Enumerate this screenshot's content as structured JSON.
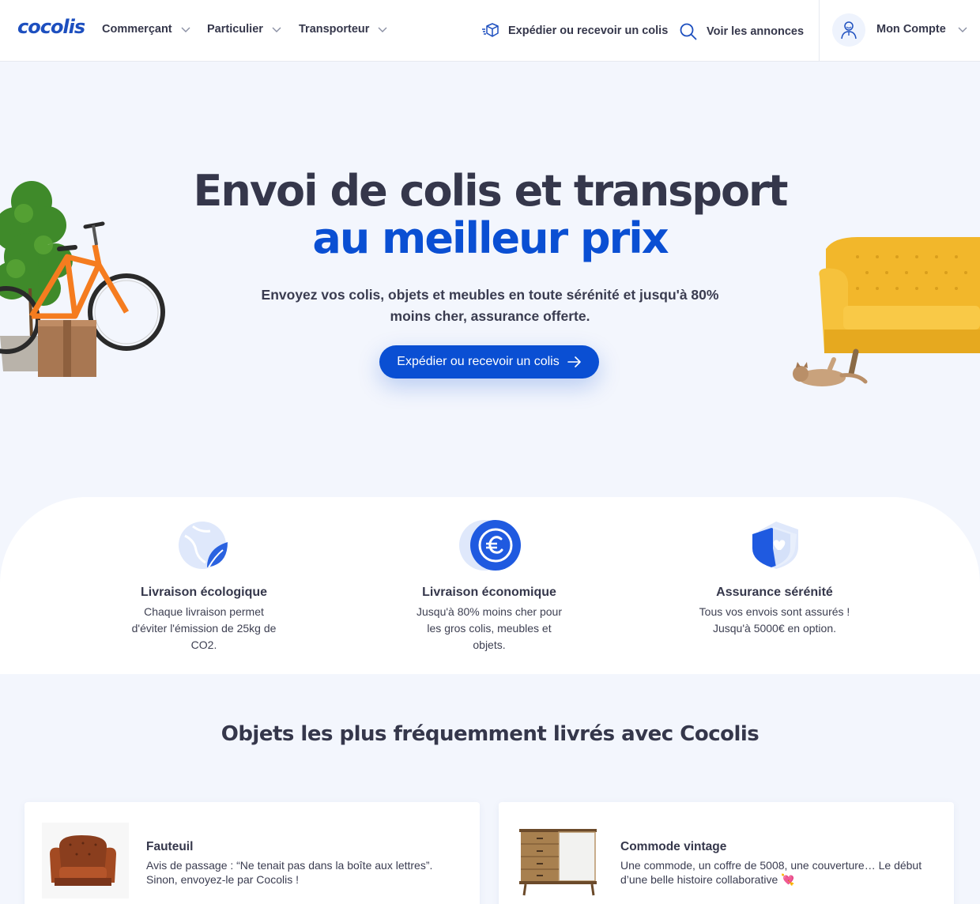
{
  "header": {
    "logo": "cocolis",
    "nav": [
      {
        "label": "Commerçant"
      },
      {
        "label": "Particulier"
      },
      {
        "label": "Transporteur"
      }
    ],
    "actions": {
      "ship_label": "Expédier ou recevoir un colis",
      "listings_label": "Voir les annonces"
    },
    "account_label": "Mon Compte"
  },
  "hero": {
    "title_line1": "Envoi de colis et transport",
    "title_line2": "au meilleur prix",
    "subtitle": "Envoyez vos colis, objets et meubles en toute sérénité et jusqu'à 80% moins cher, assurance offerte.",
    "cta_label": "Expédier ou recevoir un colis"
  },
  "features": [
    {
      "title": "Livraison écologique",
      "description": "Chaque livraison permet d'éviter l'émission de 25kg de CO2.",
      "icon": "leaf-globe-icon"
    },
    {
      "title": "Livraison économique",
      "description": "Jusqu'à 80% moins cher pour les gros colis, meubles et objets.",
      "icon": "euro-coin-icon"
    },
    {
      "title": "Assurance sérénité",
      "description": "Tous vos envois sont assurés ! Jusqu'à 5000€ en option.",
      "icon": "shield-heart-icon"
    }
  ],
  "objects": {
    "title": "Objets les plus fréquemment livrés avec Cocolis",
    "items": [
      {
        "title": "Fauteuil",
        "description": "Avis de passage : “Ne tenait pas dans la boîte aux lettres”. Sinon, envoyez-le par Cocolis !"
      },
      {
        "title": "Commode vintage",
        "description": "Une commode, un coffre de 5008, une couverture… Le début d’une belle histoire collaborative 💘"
      }
    ]
  },
  "colors": {
    "brand_blue": "#0a4fd3",
    "text_dark": "#35374b",
    "page_bg": "#f3f6fd",
    "sofa_yellow": "#f2b72b",
    "bike_orange": "#f57c1f"
  }
}
